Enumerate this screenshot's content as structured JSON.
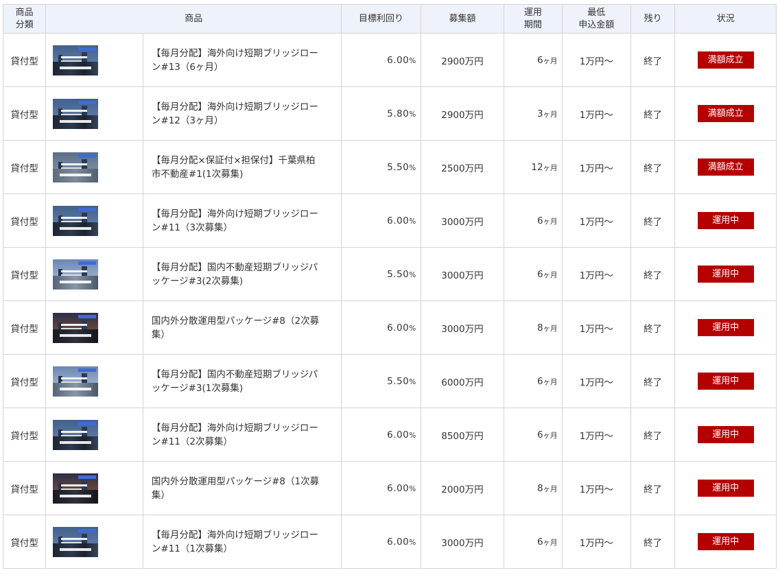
{
  "headers": {
    "category": [
      "商品",
      "分類"
    ],
    "product": "商品",
    "target_yield": "目標利回り",
    "amount": "募集額",
    "period": [
      "運用",
      "期間"
    ],
    "min_amount": [
      "最低",
      "申込金額"
    ],
    "remaining": "残り",
    "status": "状況"
  },
  "rows": [
    {
      "type": "貸付型",
      "name": [
        "【毎月分配】海外向け短期ブリッジロー",
        "ン#13（6ヶ月）"
      ],
      "rate": "6.00",
      "rate_unit": "%",
      "amount": "2900万円",
      "period": "6",
      "period_unit": "ヶ月",
      "min": "1万円～",
      "remaining": "終了",
      "status": "満額成立",
      "thumb_style": "v-a"
    },
    {
      "type": "貸付型",
      "name": [
        "【毎月分配】海外向け短期ブリッジロー",
        "ン#12（3ヶ月）"
      ],
      "rate": "5.80",
      "rate_unit": "%",
      "amount": "2900万円",
      "period": "3",
      "period_unit": "ヶ月",
      "min": "1万円～",
      "remaining": "終了",
      "status": "満額成立",
      "thumb_style": "v-a"
    },
    {
      "type": "貸付型",
      "name": [
        "【毎月分配×保証付×担保付】千葉県柏",
        "市不動産#1(1次募集)"
      ],
      "rate": "5.50",
      "rate_unit": "%",
      "amount": "2500万円",
      "period": "12",
      "period_unit": "ヶ月",
      "min": "1万円～",
      "remaining": "終了",
      "status": "満額成立",
      "thumb_style": "v-b"
    },
    {
      "type": "貸付型",
      "name": [
        "【毎月分配】海外向け短期ブリッジロー",
        "ン#11（3次募集）"
      ],
      "rate": "6.00",
      "rate_unit": "%",
      "amount": "3000万円",
      "period": "6",
      "period_unit": "ヶ月",
      "min": "1万円～",
      "remaining": "終了",
      "status": "運用中",
      "thumb_style": "v-a"
    },
    {
      "type": "貸付型",
      "name": [
        "【毎月分配】国内不動産短期ブリッジパ",
        "ッケージ#3(2次募集)"
      ],
      "rate": "5.50",
      "rate_unit": "%",
      "amount": "3000万円",
      "period": "6",
      "period_unit": "ヶ月",
      "min": "1万円～",
      "remaining": "終了",
      "status": "運用中",
      "thumb_style": "v-c"
    },
    {
      "type": "貸付型",
      "name": [
        "国内外分散運用型パッケージ#8（2次募",
        "集）"
      ],
      "rate": "6.00",
      "rate_unit": "%",
      "amount": "3000万円",
      "period": "8",
      "period_unit": "ヶ月",
      "min": "1万円～",
      "remaining": "終了",
      "status": "運用中",
      "thumb_style": "v-d"
    },
    {
      "type": "貸付型",
      "name": [
        "【毎月分配】国内不動産短期ブリッジパ",
        "ッケージ#3(1次募集)"
      ],
      "rate": "5.50",
      "rate_unit": "%",
      "amount": "6000万円",
      "period": "6",
      "period_unit": "ヶ月",
      "min": "1万円～",
      "remaining": "終了",
      "status": "運用中",
      "thumb_style": "v-c"
    },
    {
      "type": "貸付型",
      "name": [
        "【毎月分配】海外向け短期ブリッジロー",
        "ン#11（2次募集）"
      ],
      "rate": "6.00",
      "rate_unit": "%",
      "amount": "8500万円",
      "period": "6",
      "period_unit": "ヶ月",
      "min": "1万円～",
      "remaining": "終了",
      "status": "運用中",
      "thumb_style": "v-a"
    },
    {
      "type": "貸付型",
      "name": [
        "国内外分散運用型パッケージ#8（1次募",
        "集）"
      ],
      "rate": "6.00",
      "rate_unit": "%",
      "amount": "2000万円",
      "period": "8",
      "period_unit": "ヶ月",
      "min": "1万円～",
      "remaining": "終了",
      "status": "運用中",
      "thumb_style": "v-d"
    },
    {
      "type": "貸付型",
      "name": [
        "【毎月分配】海外向け短期ブリッジロー",
        "ン#11（1次募集）"
      ],
      "rate": "6.00",
      "rate_unit": "%",
      "amount": "3000万円",
      "period": "6",
      "period_unit": "ヶ月",
      "min": "1万円～",
      "remaining": "終了",
      "status": "運用中",
      "thumb_style": "v-a"
    }
  ],
  "colors": {
    "header_bg": "#eef2fb",
    "badge_bg": "#b50000",
    "border": "#d4d4d4"
  }
}
